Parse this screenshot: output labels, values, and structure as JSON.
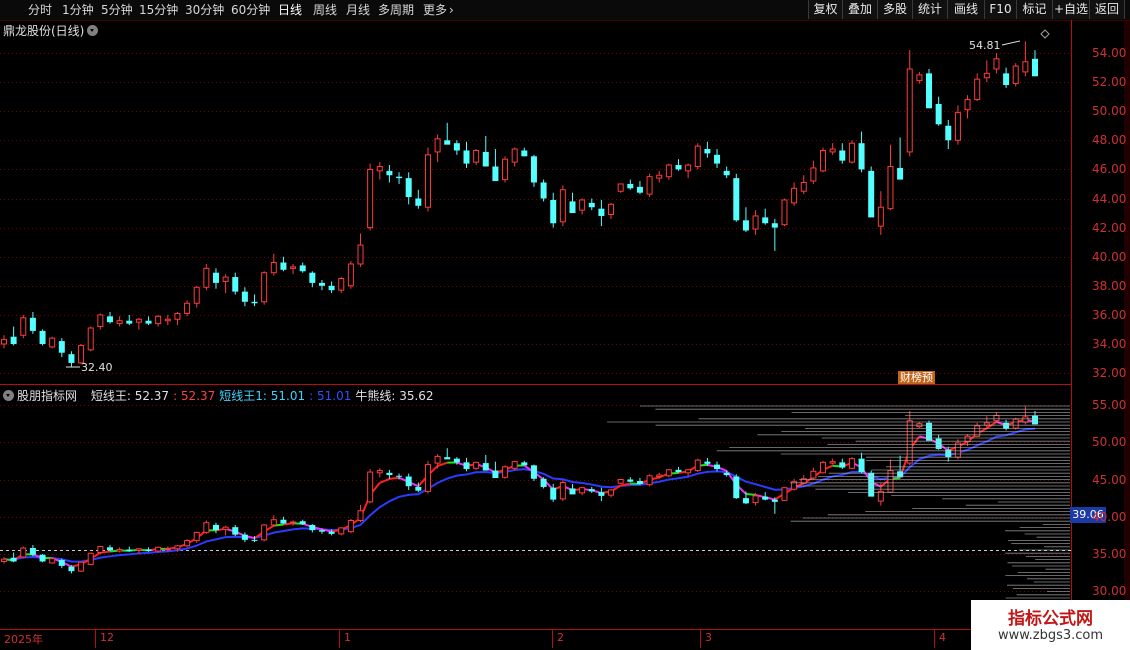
{
  "toolbar": {
    "periods": [
      "分时",
      "1分钟",
      "5分钟",
      "15分钟",
      "30分钟",
      "60分钟",
      "日线",
      "周线",
      "月线",
      "多周期",
      "更多"
    ],
    "active_period": "日线",
    "buttons": [
      "复权",
      "叠加",
      "多股",
      "统计",
      "画线",
      "F10",
      "标记",
      "+自选",
      "返回"
    ]
  },
  "main": {
    "title": "鼎龙股份(日线)",
    "high_label": "54.81",
    "low_label": "32.40",
    "badge": "财榜预"
  },
  "indicator": {
    "name": "股朋指标网",
    "fields": [
      {
        "text": "短线王: 52.37",
        "color": "#e0e0e0"
      },
      {
        "text": ": 52.37",
        "color": "#ff4040"
      },
      {
        "text": "短线王1: 51.01",
        "color": "#40d0ff"
      },
      {
        "text": ": 51.01",
        "color": "#3050ff"
      },
      {
        "text": "牛熊线: 35.62",
        "color": "#e0e0e0"
      }
    ],
    "price_tag": "39.06"
  },
  "axes": {
    "main_y": [
      "54.00",
      "52.00",
      "50.00",
      "48.00",
      "46.00",
      "44.00",
      "42.00",
      "40.00",
      "38.00",
      "36.00",
      "34.00",
      "32.00"
    ],
    "sub_y": [
      "55.00",
      "50.00",
      "45.00",
      "40.00",
      "35.00",
      "30.00"
    ],
    "dates": [
      "2025年",
      "12",
      "1",
      "2",
      "3",
      "4"
    ]
  },
  "watermark": {
    "title": "指标公式网",
    "url": "www.zbgs3.com"
  },
  "colors": {
    "up": "#ff3b3b",
    "down": "#54ffff",
    "ma_blue": "#2a3cff",
    "grid": "#7a0000"
  },
  "chart_data": {
    "type": "candlestick",
    "ohlc": [
      [
        34.0,
        34.6,
        33.7,
        34.3
      ],
      [
        34.5,
        35.2,
        33.9,
        34.0
      ],
      [
        34.6,
        36.0,
        34.4,
        35.8
      ],
      [
        35.8,
        36.2,
        34.7,
        34.9
      ],
      [
        34.9,
        35.0,
        33.9,
        34.0
      ],
      [
        33.8,
        34.5,
        33.7,
        34.4
      ],
      [
        34.2,
        34.4,
        33.1,
        33.4
      ],
      [
        33.3,
        33.5,
        32.4,
        32.7
      ],
      [
        32.7,
        34.0,
        32.6,
        33.9
      ],
      [
        33.6,
        35.2,
        33.5,
        35.1
      ],
      [
        35.2,
        36.1,
        35.0,
        36.0
      ],
      [
        35.9,
        36.2,
        35.4,
        35.5
      ],
      [
        35.4,
        35.9,
        35.2,
        35.6
      ],
      [
        35.6,
        36.0,
        35.3,
        35.4
      ],
      [
        35.5,
        35.8,
        35.0,
        35.7
      ],
      [
        35.6,
        35.9,
        35.3,
        35.4
      ],
      [
        35.4,
        36.0,
        35.2,
        35.9
      ],
      [
        35.6,
        36.0,
        35.3,
        35.7
      ],
      [
        35.7,
        36.2,
        35.3,
        36.1
      ],
      [
        36.1,
        37.0,
        35.9,
        36.8
      ],
      [
        36.8,
        38.0,
        36.5,
        37.9
      ],
      [
        37.9,
        39.5,
        37.7,
        39.2
      ],
      [
        38.9,
        39.2,
        37.8,
        38.2
      ],
      [
        38.3,
        38.8,
        37.5,
        38.6
      ],
      [
        38.6,
        38.9,
        37.4,
        37.6
      ],
      [
        37.6,
        37.9,
        36.6,
        36.9
      ],
      [
        36.9,
        37.4,
        36.6,
        36.8
      ],
      [
        36.9,
        39.0,
        36.7,
        38.9
      ],
      [
        38.9,
        40.2,
        38.7,
        39.6
      ],
      [
        39.6,
        40.0,
        39.0,
        39.1
      ],
      [
        39.2,
        39.5,
        38.8,
        39.3
      ],
      [
        39.4,
        39.6,
        38.9,
        39.0
      ],
      [
        38.9,
        39.0,
        37.9,
        38.2
      ],
      [
        38.2,
        38.4,
        37.7,
        38.0
      ],
      [
        38.0,
        38.3,
        37.5,
        37.7
      ],
      [
        37.7,
        38.6,
        37.5,
        38.5
      ],
      [
        38.0,
        39.7,
        37.8,
        39.5
      ],
      [
        39.5,
        41.6,
        39.3,
        40.8
      ],
      [
        42.0,
        46.4,
        41.8,
        46.0
      ],
      [
        45.9,
        46.5,
        45.3,
        46.2
      ],
      [
        45.9,
        46.3,
        45.1,
        45.6
      ],
      [
        45.5,
        45.8,
        45.0,
        45.4
      ],
      [
        45.4,
        45.8,
        43.6,
        44.1
      ],
      [
        44.0,
        44.6,
        43.3,
        43.5
      ],
      [
        43.4,
        47.5,
        43.1,
        47.0
      ],
      [
        47.2,
        48.4,
        46.5,
        48.1
      ],
      [
        48.0,
        49.2,
        47.8,
        47.7
      ],
      [
        47.8,
        48.0,
        47.0,
        47.3
      ],
      [
        47.3,
        47.9,
        46.1,
        46.4
      ],
      [
        46.5,
        47.4,
        46.3,
        47.3
      ],
      [
        47.2,
        48.3,
        46.4,
        46.2
      ],
      [
        46.2,
        47.4,
        45.6,
        45.2
      ],
      [
        45.3,
        46.9,
        45.1,
        46.7
      ],
      [
        46.5,
        47.5,
        46.2,
        47.4
      ],
      [
        47.3,
        47.5,
        46.9,
        46.9
      ],
      [
        46.9,
        47.0,
        44.8,
        45.1
      ],
      [
        45.1,
        45.3,
        43.8,
        44.0
      ],
      [
        43.9,
        44.4,
        42.0,
        42.3
      ],
      [
        42.4,
        44.9,
        42.1,
        44.6
      ],
      [
        43.8,
        44.4,
        43.5,
        43.0
      ],
      [
        43.2,
        44.0,
        42.9,
        43.9
      ],
      [
        43.7,
        44.0,
        43.2,
        43.4
      ],
      [
        43.3,
        43.9,
        42.1,
        42.8
      ],
      [
        42.9,
        43.7,
        42.6,
        43.6
      ],
      [
        44.5,
        45.0,
        44.4,
        45.0
      ],
      [
        45.0,
        45.3,
        44.6,
        44.7
      ],
      [
        44.8,
        45.2,
        44.3,
        44.4
      ],
      [
        44.3,
        45.7,
        44.1,
        45.5
      ],
      [
        45.4,
        45.9,
        45.1,
        45.6
      ],
      [
        45.5,
        46.4,
        45.3,
        46.3
      ],
      [
        46.3,
        46.7,
        45.9,
        46.0
      ],
      [
        45.9,
        46.4,
        45.4,
        46.3
      ],
      [
        46.2,
        47.8,
        46.0,
        47.6
      ],
      [
        47.4,
        47.9,
        46.8,
        47.1
      ],
      [
        47.0,
        47.4,
        46.1,
        46.4
      ],
      [
        45.9,
        46.2,
        45.4,
        45.6
      ],
      [
        45.4,
        45.7,
        42.4,
        42.5
      ],
      [
        42.5,
        43.4,
        41.7,
        41.8
      ],
      [
        41.9,
        43.2,
        41.5,
        42.8
      ],
      [
        42.7,
        43.3,
        42.2,
        42.3
      ],
      [
        42.3,
        42.6,
        40.4,
        42.0
      ],
      [
        42.2,
        44.0,
        42.1,
        43.9
      ],
      [
        43.7,
        45.1,
        43.5,
        44.7
      ],
      [
        44.5,
        45.6,
        44.3,
        45.1
      ],
      [
        45.2,
        46.6,
        45.0,
        46.1
      ],
      [
        45.9,
        47.5,
        45.8,
        47.3
      ],
      [
        47.2,
        47.8,
        47.0,
        47.4
      ],
      [
        47.3,
        47.8,
        46.4,
        46.6
      ],
      [
        46.5,
        48.0,
        46.4,
        47.8
      ],
      [
        47.8,
        48.6,
        45.8,
        46.0
      ],
      [
        45.9,
        46.2,
        43.1,
        42.7
      ],
      [
        42.1,
        44.5,
        41.5,
        43.4
      ],
      [
        43.3,
        47.7,
        43.2,
        46.2
      ],
      [
        46.1,
        48.2,
        45.7,
        45.3
      ],
      [
        47.2,
        54.2,
        46.9,
        52.9
      ],
      [
        52.1,
        52.7,
        51.9,
        52.5
      ],
      [
        52.6,
        52.9,
        51.1,
        50.2
      ],
      [
        50.5,
        51.0,
        49.0,
        49.1
      ],
      [
        49.0,
        49.4,
        47.4,
        48.0
      ],
      [
        48.0,
        50.4,
        47.7,
        49.9
      ],
      [
        50.1,
        51.1,
        49.5,
        50.8
      ],
      [
        50.8,
        52.6,
        50.7,
        52.2
      ],
      [
        52.3,
        53.5,
        52.0,
        52.6
      ],
      [
        52.9,
        54.0,
        52.6,
        53.6
      ],
      [
        52.6,
        53.0,
        51.6,
        51.8
      ],
      [
        51.9,
        53.3,
        51.7,
        53.1
      ],
      [
        52.7,
        54.8,
        52.4,
        53.4
      ],
      [
        53.6,
        54.2,
        52.4,
        52.4
      ]
    ]
  }
}
